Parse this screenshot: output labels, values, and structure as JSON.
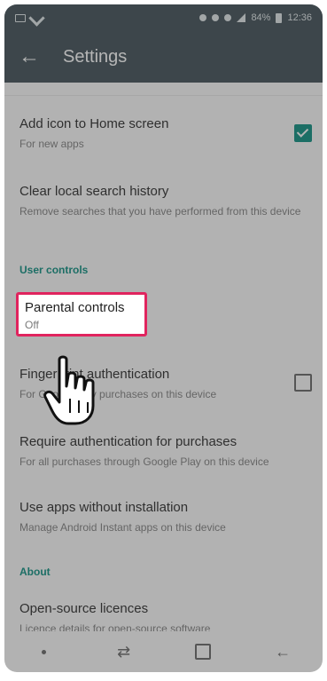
{
  "app_bar": {
    "title": "Settings",
    "back_icon": "arrow-left-icon"
  },
  "status_bar": {
    "battery": "84%",
    "time": "12:36"
  },
  "items": {
    "add_icon": {
      "title": "Add icon to Home screen",
      "subtitle": "For new apps",
      "checked": true
    },
    "clear_history": {
      "title": "Clear local search history",
      "subtitle": "Remove searches that you have performed from this device"
    },
    "parental": {
      "title": "Parental controls",
      "subtitle": "Off"
    },
    "fingerprint": {
      "title": "Fingerprint authentication",
      "subtitle": "For Google Play purchases on this device",
      "checked": false
    },
    "require_auth": {
      "title": "Require authentication for purchases",
      "subtitle": "For all purchases through Google Play on this device"
    },
    "instant_apps": {
      "title": "Use apps without installation",
      "subtitle": "Manage Android Instant apps on this device"
    },
    "licences": {
      "title": "Open-source licences",
      "subtitle": "Licence details for open-source software"
    }
  },
  "sections": {
    "user_controls": "User controls",
    "about": "About"
  },
  "colors": {
    "app_bar": "#37474f",
    "accent": "#00897b",
    "highlight": "#e0245e"
  }
}
